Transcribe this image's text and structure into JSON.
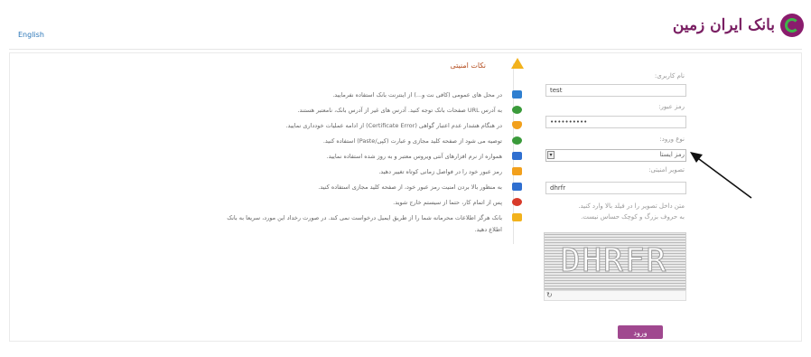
{
  "header": {
    "bank_name": "بانک ایران زمین",
    "lang_link": "English"
  },
  "form": {
    "username_label": "نام کاربری:",
    "username_value": "test",
    "password_label": "رمز عبور:",
    "password_value": "••••••••••",
    "login_type_label": "نوع ورود:",
    "login_type_value": "رمز ایستا",
    "captcha_label": "تصویر امنیتی:",
    "captcha_value": "dhrfr",
    "hint_line1": "متن داخل تصویر را در فیلد بالا وارد کنید.",
    "hint_line2": "به حروف بزرگ و کوچک حساس نیست.",
    "captcha_image_text": "DHRFR",
    "login_button": "ورود"
  },
  "tips": {
    "title": "نکات امنیتی",
    "items": [
      "در محل های عمومی (کافی نت و...) از اینترنت بانک استفاده نفرمایید.",
      "به آدرس URL صفحات بانک توجه کنید. آدرس های غیر از آدرس بانک، نامعتبر هستند.",
      "در هنگام هشدار عدم اعتبار گواهی (Certificate Error) از ادامه عملیات خودداری نمایید.",
      "توصیه می شود از صفحه کلید مجازی و عبارت (کپی/Paste) استفاده کنید.",
      "همواره از نرم افزارهای آنتی ویروس معتبر و به روز شده استفاده نمایید.",
      "رمز عبور خود را در فواصل زمانی کوتاه تغییر دهید.",
      "به منظور بالا بردن امنیت رمز عبور خود، از صفحه کلید مجازی استفاده کنید.",
      "پس از اتمام کار، حتما از سیستم خارج شوید.",
      "بانک هرگز اطلاعات محرمانه شما را از طریق ایمیل درخواست نمی کند. در صورت رخداد این مورد، سریعا به بانک",
      "اطلاع دهید."
    ]
  },
  "colors": {
    "brand": "#8a1c6d",
    "button": "#a0488f",
    "tip_icons": [
      "#2f7fd0",
      "#3a9a3a",
      "#f2a01c",
      "#3a9a3a",
      "#2f6fd0",
      "#f2a01c",
      "#2f6fd0",
      "#d83a2a",
      "#f2b21c"
    ]
  },
  "icons": [
    "logo-mark",
    "warning-icon",
    "refresh-icon",
    "pointer-arrow"
  ]
}
